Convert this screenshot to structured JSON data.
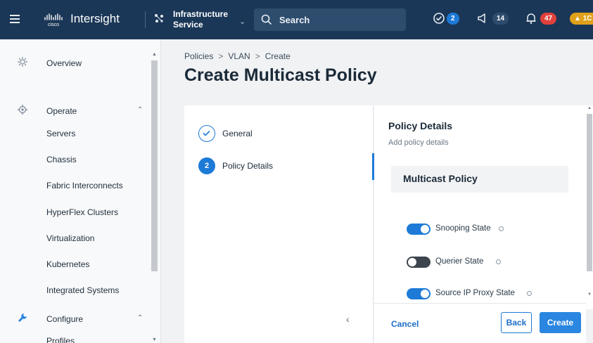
{
  "topbar": {
    "brand": "Intersight",
    "service_line1": "Infrastructure",
    "service_line2": "Service",
    "search_label": "Search",
    "status_count": "2",
    "announcements_count": "14",
    "critical_count": "47",
    "warning_count": "1C",
    "colors": {
      "bg": "#1b3757",
      "status": "#1d7ad7",
      "critical": "#e1413b",
      "warning": "#e0a11a"
    }
  },
  "sidebar": {
    "items": [
      {
        "label": "Overview",
        "icon": "overview-icon"
      },
      {
        "label": "Operate",
        "icon": "operate-icon",
        "expanded": true
      },
      {
        "label": "Servers"
      },
      {
        "label": "Chassis"
      },
      {
        "label": "Fabric Interconnects"
      },
      {
        "label": "HyperFlex Clusters"
      },
      {
        "label": "Virtualization"
      },
      {
        "label": "Kubernetes"
      },
      {
        "label": "Integrated Systems"
      },
      {
        "label": "Configure",
        "icon": "wrench-icon",
        "expanded": true
      },
      {
        "label": "Profiles"
      }
    ]
  },
  "main": {
    "breadcrumb": [
      "Policies",
      "VLAN",
      "Create"
    ],
    "title": "Create Multicast Policy",
    "steps": [
      {
        "number": "1",
        "label": "General",
        "state": "completed"
      },
      {
        "number": "2",
        "label": "Policy Details",
        "state": "active"
      }
    ],
    "details": {
      "title": "Policy Details",
      "subtitle": "Add policy details",
      "section": "Multicast Policy",
      "toggles": [
        {
          "label": "Snooping State",
          "on": true
        },
        {
          "label": "Querier State",
          "on": false
        },
        {
          "label": "Source IP Proxy State",
          "on": true
        }
      ]
    },
    "footer": {
      "cancel": "Cancel",
      "back": "Back",
      "create": "Create"
    }
  }
}
